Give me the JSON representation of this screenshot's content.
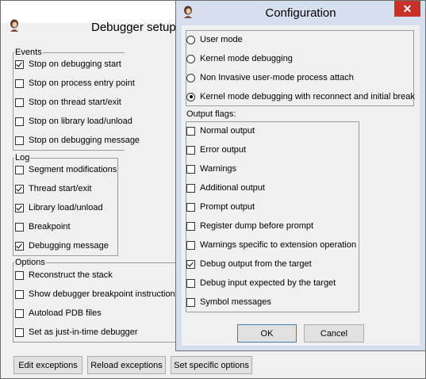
{
  "debugger_window": {
    "title": "Debugger setup",
    "icon": "app-portrait-icon",
    "events": {
      "title": "Events",
      "items": [
        {
          "label": "Stop on debugging start",
          "checked": true
        },
        {
          "label": "Stop on process entry point",
          "checked": false
        },
        {
          "label": "Stop on thread start/exit",
          "checked": false
        },
        {
          "label": "Stop on library load/unload",
          "checked": false
        },
        {
          "label": "Stop on debugging message",
          "checked": false
        }
      ]
    },
    "log": {
      "title": "Log",
      "items": [
        {
          "label": "Segment modifications",
          "checked": false
        },
        {
          "label": "Thread start/exit",
          "checked": true
        },
        {
          "label": "Library load/unload",
          "checked": true
        },
        {
          "label": "Breakpoint",
          "checked": false
        },
        {
          "label": "Debugging message",
          "checked": true
        }
      ]
    },
    "options": {
      "title": "Options",
      "items": [
        {
          "label": "Reconstruct the stack",
          "checked": false
        },
        {
          "label": "Show debugger breakpoint instruction",
          "checked": false
        },
        {
          "label": "Autoload PDB files",
          "checked": false
        },
        {
          "label": "Set as just-in-time debugger",
          "checked": false
        }
      ]
    },
    "buttons": {
      "edit_exceptions": "Edit exceptions",
      "reload_exceptions": "Reload exceptions",
      "set_specific_options": "Set specific options"
    }
  },
  "config_dialog": {
    "title": "Configuration",
    "close_glyph": "✕",
    "modes": [
      {
        "label": "User mode",
        "selected": false
      },
      {
        "label": "Kernel mode debugging",
        "selected": false
      },
      {
        "label": "Non Invasive user-mode process attach",
        "selected": false
      },
      {
        "label": "Kernel mode debugging with reconnect and initial break",
        "selected": true
      }
    ],
    "output_flags_label": "Output flags:",
    "output_flags": [
      {
        "label": "Normal output",
        "checked": false
      },
      {
        "label": "Error output",
        "checked": false
      },
      {
        "label": "Warnings",
        "checked": false
      },
      {
        "label": "Additional output",
        "checked": false
      },
      {
        "label": "Prompt output",
        "checked": false
      },
      {
        "label": "Register dump before prompt",
        "checked": false
      },
      {
        "label": "Warnings specific to extension operation",
        "checked": false
      },
      {
        "label": "Debug output from the target",
        "checked": true
      },
      {
        "label": "Debug input expected by the target",
        "checked": false
      },
      {
        "label": "Symbol messages",
        "checked": false
      }
    ],
    "ok_label": "OK",
    "cancel_label": "Cancel"
  },
  "colors": {
    "dialog_frame": "#d5dff0",
    "close_button": "#c7312a",
    "window_bg": "#f0f0f0"
  }
}
